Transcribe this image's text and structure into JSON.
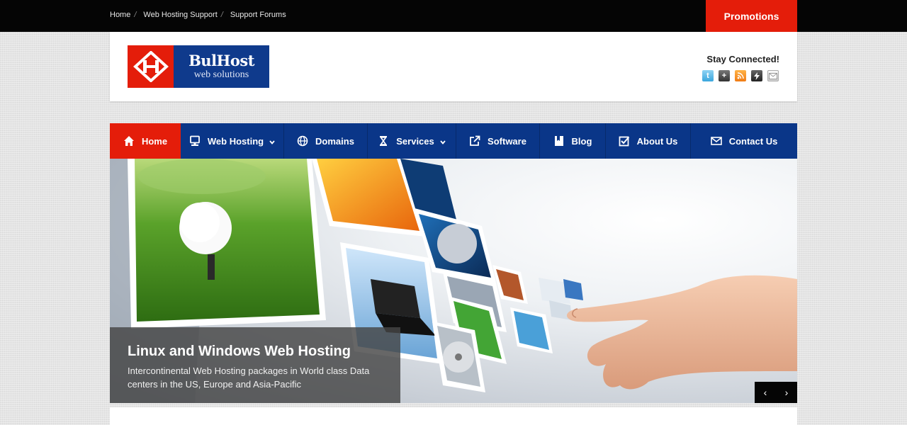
{
  "topbar": {
    "breadcrumbs": [
      "Home",
      "Web Hosting Support",
      "Support Forums"
    ],
    "separator": "/",
    "promo_label": "Promotions"
  },
  "header": {
    "logo": {
      "name": "BulHost",
      "tagline": "web solutions"
    },
    "stay_connected": "Stay Connected!",
    "social_icons": [
      "twitter-icon",
      "plus-icon",
      "rss-icon",
      "bolt-icon",
      "mail-icon"
    ]
  },
  "nav": {
    "items": [
      {
        "label": "Home",
        "icon": "home-icon",
        "active": true
      },
      {
        "label": "Web Hosting",
        "icon": "server-icon",
        "dropdown": true
      },
      {
        "label": "Domains",
        "icon": "globe-icon"
      },
      {
        "label": "Services",
        "icon": "hourglass-icon",
        "dropdown": true
      },
      {
        "label": "Software",
        "icon": "external-link-icon"
      },
      {
        "label": "Blog",
        "icon": "bookmark-icon"
      },
      {
        "label": "About Us",
        "icon": "checkbox-icon"
      },
      {
        "label": "Contact Us",
        "icon": "envelope-icon"
      }
    ]
  },
  "slider": {
    "title": "Linux and Windows Web Hosting",
    "text": "Intercontinental Web Hosting packages in World class Data centers in the US, Europe and Asia-Pacific",
    "prev": "‹",
    "next": "›"
  },
  "colors": {
    "accent_red": "#e41d0a",
    "nav_blue": "#0a3688",
    "topbar_black": "#050505"
  }
}
